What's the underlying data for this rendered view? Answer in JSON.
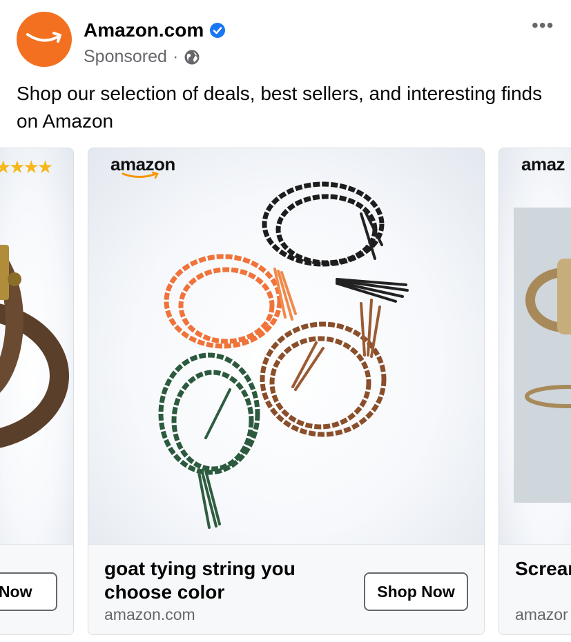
{
  "post": {
    "page_name": "Amazon.com",
    "sponsored": "Sponsored",
    "separator": "·",
    "more_glyph": "•••",
    "caption": "Shop our selection of deals, best sellers, and interesting finds on Amazon"
  },
  "icons": {
    "avatar": "amazon-smile-logo",
    "verified": "verified-badge-icon",
    "audience": "globe-icon",
    "more": "more-options-icon"
  },
  "colors": {
    "avatar_bg": "#f37021",
    "verified": "#1877f2",
    "secondary_text": "#65676b"
  },
  "carousel": {
    "cards": [
      {
        "title": "",
        "domain": "",
        "cta": "p Now",
        "logo": "",
        "rating_stars": "★★★★"
      },
      {
        "title": "goat tying string you choose color",
        "domain": "amazon.com",
        "cta": "Shop Now",
        "logo": "amazon"
      },
      {
        "title": "Screar Whistl",
        "domain": "amazor",
        "cta": "",
        "logo": "amaz"
      }
    ]
  }
}
